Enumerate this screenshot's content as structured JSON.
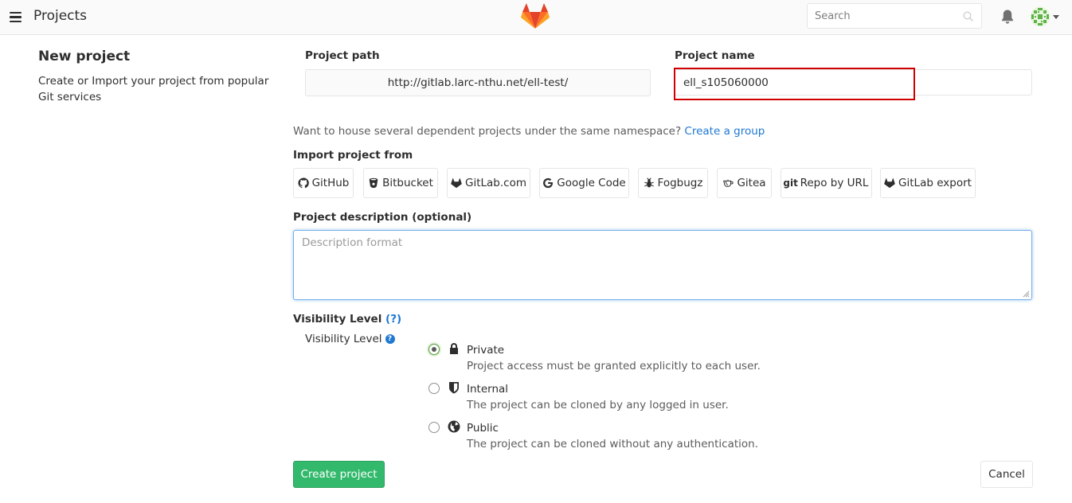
{
  "header": {
    "title": "Projects",
    "search_placeholder": "Search"
  },
  "left": {
    "title": "New project",
    "description": "Create or Import your project from popular Git services"
  },
  "form": {
    "path_label": "Project path",
    "path_value": "http://gitlab.larc-nthu.net/ell-test/",
    "name_label": "Project name",
    "name_value": "ell_s105060000",
    "namespace_text": "Want to house several dependent projects under the same namespace? ",
    "namespace_link": "Create a group",
    "import_label": "Import project from",
    "import_buttons": [
      "GitHub",
      "Bitbucket",
      "GitLab.com",
      "Google Code",
      "Fogbugz",
      "Gitea",
      "Repo by URL",
      "GitLab export"
    ],
    "description_label": "Project description (optional)",
    "description_placeholder": "Description format",
    "visibility_heading": "Visibility Level",
    "visibility_help": "(?)",
    "visibility_sub_label": "Visibility Level",
    "visibility_options": [
      {
        "title": "Private",
        "desc": "Project access must be granted explicitly to each user.",
        "checked": true,
        "icon": "lock-icon"
      },
      {
        "title": "Internal",
        "desc": "The project can be cloned by any logged in user.",
        "checked": false,
        "icon": "shield-icon"
      },
      {
        "title": "Public",
        "desc": "The project can be cloned without any authentication.",
        "checked": false,
        "icon": "globe-icon"
      }
    ],
    "create_button": "Create project",
    "cancel_button": "Cancel"
  },
  "colors": {
    "accent_link": "#1f78d1",
    "create_green": "#33b96c",
    "highlight_red": "#d10000",
    "logo_orange": "#fc6d26"
  }
}
